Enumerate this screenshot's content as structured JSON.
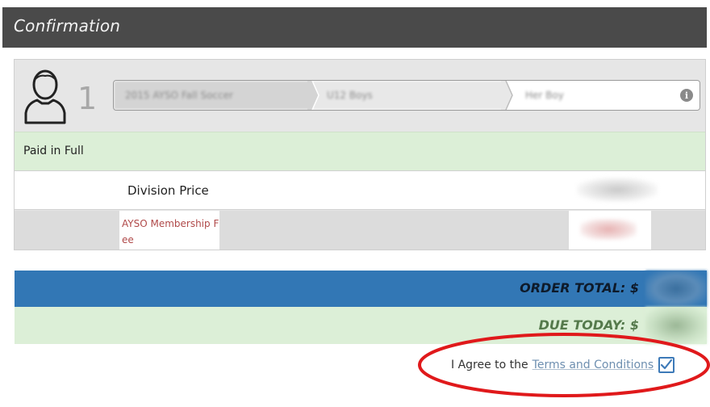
{
  "header": {
    "title": "Confirmation"
  },
  "player": {
    "number": "1",
    "breadcrumb": [
      {
        "label": "2015 AYSO Fall Soccer"
      },
      {
        "label": "U12 Boys"
      },
      {
        "label": "Her Boy"
      }
    ],
    "icons": {
      "avatar": "user-icon",
      "info": "info-icon"
    }
  },
  "payment_status": {
    "label": "Paid in Full"
  },
  "line_items": [
    {
      "label": "Division Price"
    },
    {
      "label": "AYSO Membership Fee"
    }
  ],
  "summary": {
    "order_total_label": "ORDER TOTAL: $",
    "due_today_label": "DUE TODAY: $"
  },
  "agreement": {
    "prefix": "I Agree to the",
    "link_text": "Terms and Conditions",
    "checked": true
  },
  "colors": {
    "header_bg": "#4a4a4a",
    "paid_bg": "#dcefd7",
    "total_bg": "#3277b5",
    "annotation": "#e0191b"
  }
}
